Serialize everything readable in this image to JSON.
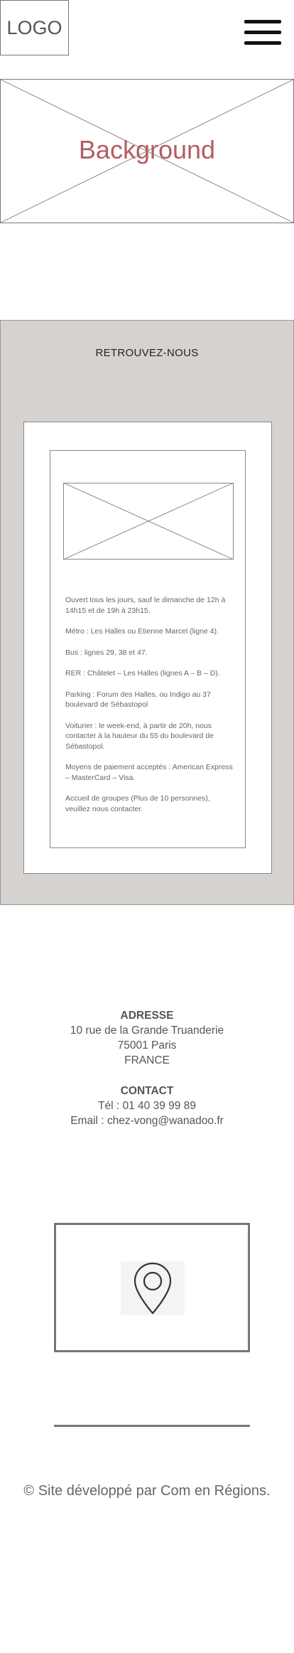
{
  "header": {
    "logo": "LOGO",
    "menu_icon": "hamburger-icon"
  },
  "hero": {
    "label": "Background"
  },
  "info": {
    "title": "RETROUVEZ-NOUS",
    "lines": [
      "Ouvert tous les jours, sauf le dimanche de 12h à 14h15 et de 19h à 23h15.",
      "Métro : Les Halles ou Etienne Marcel (ligne 4).",
      "Bus : lignes 29, 38 et 47.",
      "RER : Châtelet – Les Halles (lignes A – B – D).",
      "Parking : Forum des Halles, ou Indigo au 37 boulevard de Sébastopol",
      "Voiturier : le week-end, à partir de 20h, nous contacter à la hauteur du 55 du boulevard de Sébastopol.",
      "Moyens de paiement acceptés : American Express – MasterCard – Visa.",
      "Accueil de groupes (Plus de 10 personnes), veuillez nous contacter."
    ]
  },
  "contact": {
    "address_heading": "ADRESSE",
    "street": "10 rue de la Grande Truanderie",
    "city": "75001 Paris",
    "country": "FRANCE",
    "contact_heading": "CONTACT",
    "phone": "Tél : 01 40 39 99 89",
    "email": "Email : chez-vong@wanadoo.fr"
  },
  "map": {
    "icon": "map-pin-icon"
  },
  "footer": {
    "copyright": "© Site développé par Com en Régions."
  },
  "colors": {
    "section_bg": "#d6d2cf",
    "hero_text": "#b35e5e",
    "border": "#777777"
  }
}
